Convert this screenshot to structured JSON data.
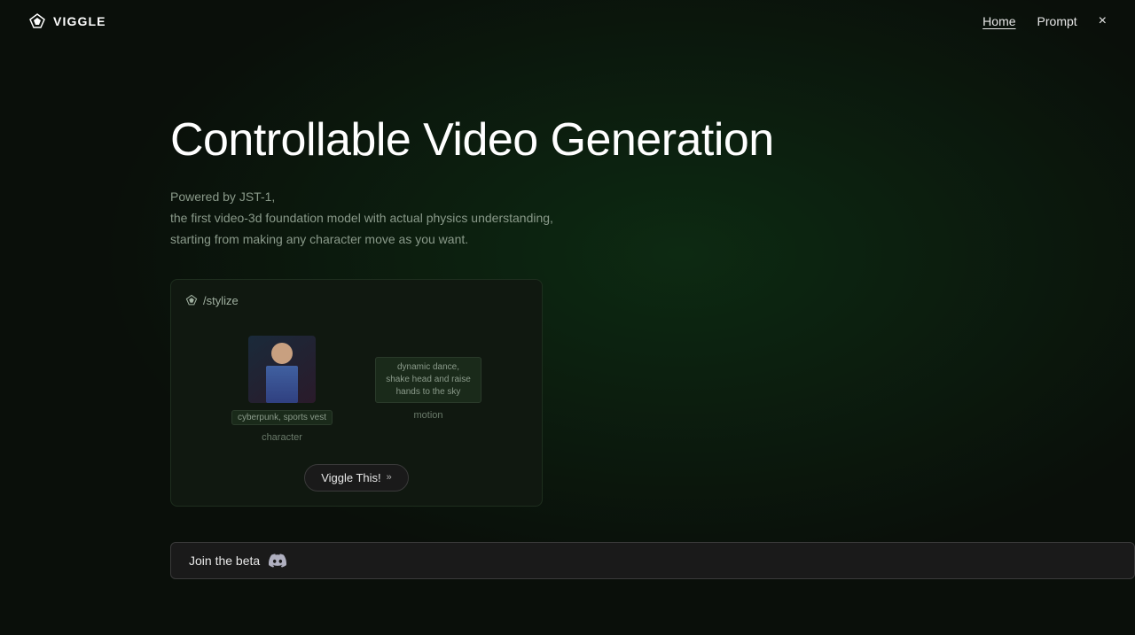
{
  "nav": {
    "logo_text": "VIGGLE",
    "links": [
      {
        "label": "Home",
        "active": true
      },
      {
        "label": "Prompt",
        "active": false
      }
    ],
    "close_label": "×"
  },
  "hero": {
    "title": "Controllable Video Generation",
    "subtitle_line1": "Powered by JST-1,",
    "subtitle_line2": "the first video-3d foundation model with actual physics understanding,",
    "subtitle_line3": "starting from making any character move as you want."
  },
  "demo_card": {
    "command": "/stylize",
    "character_tag": "cyberpunk, sports vest",
    "character_label": "character",
    "motion_tag": "dynamic dance, shake head and raise hands to the sky",
    "motion_label": "motion",
    "button_label": "Viggle This!",
    "button_icon": "»"
  },
  "join_beta": {
    "label": "Join the beta"
  }
}
